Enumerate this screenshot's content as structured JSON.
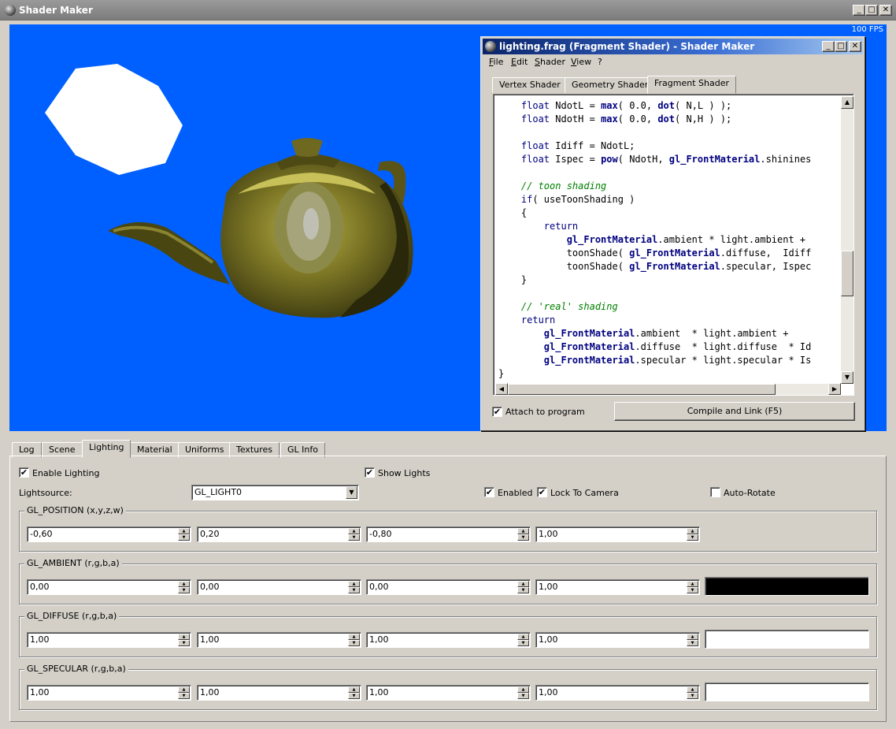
{
  "window": {
    "title": "Shader Maker",
    "minimize_glyph": "_",
    "maximize_glyph": "□",
    "close_glyph": "✕"
  },
  "viewport": {
    "fps": "100 FPS",
    "background_color": "#0060ff"
  },
  "shader_window": {
    "title": "lighting.frag (Fragment Shader)  - Shader Maker",
    "menu": [
      "File",
      "Edit",
      "Shader",
      "View",
      "?"
    ],
    "tabs": [
      "Vertex Shader",
      "Geometry Shader",
      "Fragment Shader"
    ],
    "active_tab": "Fragment Shader",
    "code_lines": [
      [
        {
          "t": "    "
        },
        {
          "t": "float",
          "c": "kw"
        },
        {
          "t": " NdotL = "
        },
        {
          "t": "max",
          "c": "fn"
        },
        {
          "t": "( 0.0, "
        },
        {
          "t": "dot",
          "c": "fn"
        },
        {
          "t": "( N,L ) );"
        }
      ],
      [
        {
          "t": "    "
        },
        {
          "t": "float",
          "c": "kw"
        },
        {
          "t": " NdotH = "
        },
        {
          "t": "max",
          "c": "fn"
        },
        {
          "t": "( 0.0, "
        },
        {
          "t": "dot",
          "c": "fn"
        },
        {
          "t": "( N,H ) );"
        }
      ],
      [
        {
          "t": ""
        }
      ],
      [
        {
          "t": "    "
        },
        {
          "t": "float",
          "c": "kw"
        },
        {
          "t": " Idiff = NdotL;"
        }
      ],
      [
        {
          "t": "    "
        },
        {
          "t": "float",
          "c": "kw"
        },
        {
          "t": " Ispec = "
        },
        {
          "t": "pow",
          "c": "fn"
        },
        {
          "t": "( NdotH, "
        },
        {
          "t": "gl_FrontMaterial",
          "c": "fn"
        },
        {
          "t": ".shinines"
        }
      ],
      [
        {
          "t": ""
        }
      ],
      [
        {
          "t": "    "
        },
        {
          "t": "// toon shading",
          "c": "cm"
        }
      ],
      [
        {
          "t": "    "
        },
        {
          "t": "if",
          "c": "kw"
        },
        {
          "t": "( useToonShading )"
        }
      ],
      [
        {
          "t": "    {"
        }
      ],
      [
        {
          "t": "        "
        },
        {
          "t": "return",
          "c": "kw"
        }
      ],
      [
        {
          "t": "            "
        },
        {
          "t": "gl_FrontMaterial",
          "c": "fn"
        },
        {
          "t": ".ambient * light.ambient +"
        }
      ],
      [
        {
          "t": "            toonShade( "
        },
        {
          "t": "gl_FrontMaterial",
          "c": "fn"
        },
        {
          "t": ".diffuse,  Idiff"
        }
      ],
      [
        {
          "t": "            toonShade( "
        },
        {
          "t": "gl_FrontMaterial",
          "c": "fn"
        },
        {
          "t": ".specular, Ispec"
        }
      ],
      [
        {
          "t": "    }"
        }
      ],
      [
        {
          "t": ""
        }
      ],
      [
        {
          "t": "    "
        },
        {
          "t": "// 'real' shading",
          "c": "cm"
        }
      ],
      [
        {
          "t": "    "
        },
        {
          "t": "return",
          "c": "kw"
        }
      ],
      [
        {
          "t": "        "
        },
        {
          "t": "gl_FrontMaterial",
          "c": "fn"
        },
        {
          "t": ".ambient  * light.ambient +"
        }
      ],
      [
        {
          "t": "        "
        },
        {
          "t": "gl_FrontMaterial",
          "c": "fn"
        },
        {
          "t": ".diffuse  * light.diffuse  * Id"
        }
      ],
      [
        {
          "t": "        "
        },
        {
          "t": "gl_FrontMaterial",
          "c": "fn"
        },
        {
          "t": ".specular * light.specular * Is"
        }
      ],
      [
        {
          "t": "}"
        }
      ]
    ],
    "attach_label": "Attach to program",
    "attach_checked": true,
    "compile_label": "Compile and Link (F5)",
    "check_glyph": "✔",
    "arrow_up": "▲",
    "arrow_down": "▼",
    "arrow_left": "◀",
    "arrow_right": "▶"
  },
  "bottom_tabs": [
    "Log",
    "Scene",
    "Lighting",
    "Material",
    "Uniforms",
    "Textures",
    "GL Info"
  ],
  "active_bottom_tab": "Lighting",
  "lighting": {
    "enable_lighting_label": "Enable Lighting",
    "enable_lighting_checked": true,
    "show_lights_label": "Show Lights",
    "show_lights_checked": true,
    "lightsource_label": "Lightsource:",
    "lightsource_value": "GL_LIGHT0",
    "enabled_label": "Enabled",
    "enabled_checked": true,
    "lock_camera_label": "Lock To Camera",
    "lock_camera_checked": true,
    "auto_rotate_label": "Auto-Rotate",
    "auto_rotate_checked": false,
    "groups": [
      {
        "title": "GL_POSITION  (x,y,z,w)",
        "values": [
          "-0,60",
          "0,20",
          "-0,80",
          "1,00"
        ],
        "swatch": null
      },
      {
        "title": "GL_AMBIENT  (r,g,b,a)",
        "values": [
          "0,00",
          "0,00",
          "0,00",
          "1,00"
        ],
        "swatch": "#000000"
      },
      {
        "title": "GL_DIFFUSE  (r,g,b,a)",
        "values": [
          "1,00",
          "1,00",
          "1,00",
          "1,00"
        ],
        "swatch": "#ffffff"
      },
      {
        "title": "GL_SPECULAR  (r,g,b,a)",
        "values": [
          "1,00",
          "1,00",
          "1,00",
          "1,00"
        ],
        "swatch": "#ffffff"
      }
    ]
  }
}
